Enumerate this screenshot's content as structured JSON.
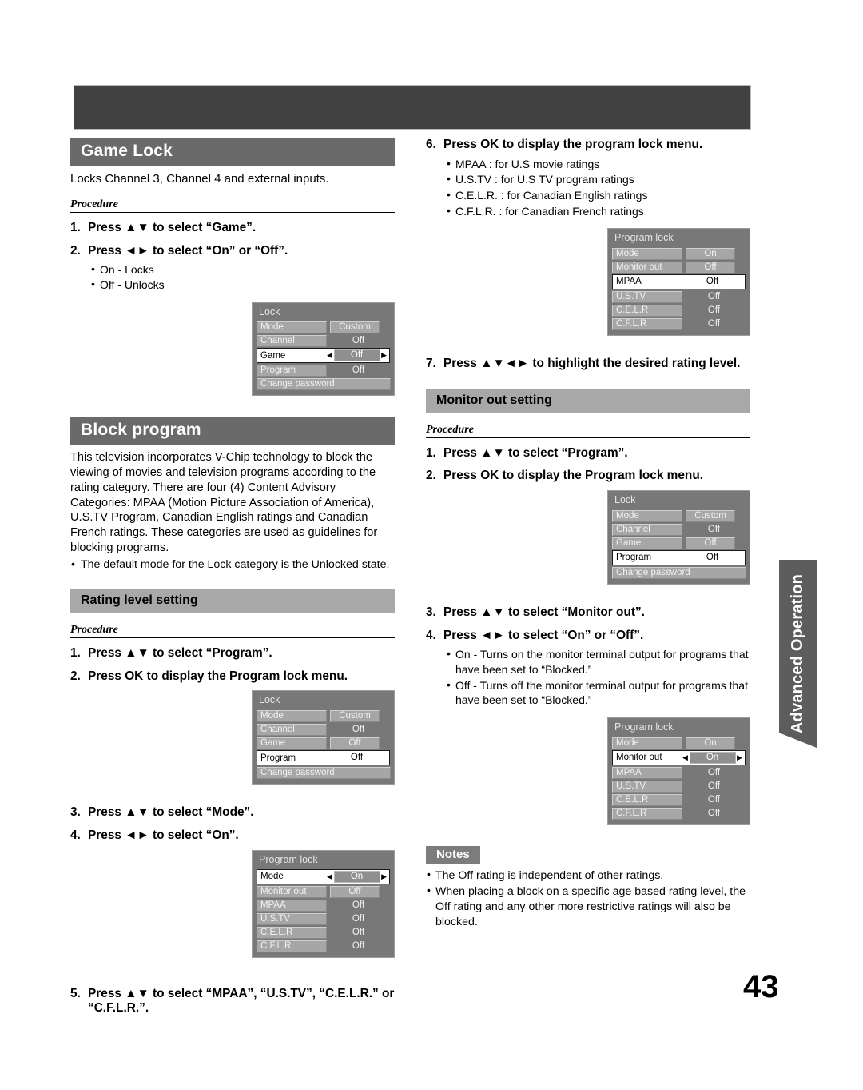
{
  "page": {
    "number": "43",
    "side_tab": "Advanced Operation"
  },
  "game_lock": {
    "heading": "Game Lock",
    "intro": "Locks Channel 3, Channel 4 and external inputs.",
    "procedure_label": "Procedure",
    "steps": [
      {
        "num": "1.",
        "text": "Press ▲▼ to select “Game”."
      },
      {
        "num": "2.",
        "text": "Press ◄► to select “On” or “Off”."
      }
    ],
    "bullets": [
      "On - Locks",
      "Off - Unlocks"
    ],
    "osd": {
      "title": "Lock",
      "rows": [
        {
          "label": "Mode",
          "value": "Custom",
          "style": "boxed",
          "selected": false
        },
        {
          "label": "Channel",
          "value": "Off",
          "style": "plain",
          "selected": false
        },
        {
          "label": "Game",
          "value": "Off",
          "style": "boxed",
          "selected": true
        },
        {
          "label": "Program",
          "value": "Off",
          "style": "plain",
          "selected": false
        },
        {
          "label": "Change password",
          "value": "",
          "style": "none",
          "selected": false
        }
      ]
    }
  },
  "block_program": {
    "heading": "Block program",
    "paragraph": "This television incorporates V-Chip technology to block the viewing of movies and television programs according to the rating category. There are four (4) Content Advisory Categories: MPAA (Motion Picture Association of America), U.S.TV Program, Canadian English ratings and Canadian French ratings. These categories are used as guidelines for blocking programs.",
    "note": "The default mode for the Lock category is the Unlocked state."
  },
  "rating_level": {
    "heading": "Rating level setting",
    "procedure_label": "Procedure",
    "steps_a": [
      {
        "num": "1.",
        "text": "Press ▲▼ to select “Program”."
      },
      {
        "num": "2.",
        "text": "Press OK to display the Program lock menu."
      }
    ],
    "osd_a": {
      "title": "Lock",
      "rows": [
        {
          "label": "Mode",
          "value": "Custom",
          "style": "boxed",
          "selected": false
        },
        {
          "label": "Channel",
          "value": "Off",
          "style": "plain",
          "selected": false
        },
        {
          "label": "Game",
          "value": "Off",
          "style": "boxed",
          "selected": false
        },
        {
          "label": "Program",
          "value": "Off",
          "style": "plain",
          "selected": true
        },
        {
          "label": "Change password",
          "value": "",
          "style": "none",
          "selected": false
        }
      ]
    },
    "steps_b": [
      {
        "num": "3.",
        "text": "Press ▲▼ to select “Mode”."
      },
      {
        "num": "4.",
        "text": "Press ◄► to select “On”."
      }
    ],
    "osd_b": {
      "title": "Program lock",
      "rows": [
        {
          "label": "Mode",
          "value": "On",
          "style": "boxed",
          "selected": true
        },
        {
          "label": "Monitor out",
          "value": "Off",
          "style": "boxed",
          "selected": false
        },
        {
          "label": "MPAA",
          "value": "Off",
          "style": "plain",
          "selected": false
        },
        {
          "label": "U.S.TV",
          "value": "Off",
          "style": "plain",
          "selected": false
        },
        {
          "label": "C.E.L.R",
          "value": "Off",
          "style": "plain",
          "selected": false
        },
        {
          "label": "C.F.L.R",
          "value": "Off",
          "style": "plain",
          "selected": false
        }
      ]
    },
    "step5": {
      "num": "5.",
      "text": "Press ▲▼ to select “MPAA”, “U.S.TV”, “C.E.L.R.” or “C.F.L.R.”."
    },
    "step6": {
      "num": "6.",
      "text": "Press OK to display the program lock menu."
    },
    "step6_bullets": [
      "MPAA : for U.S movie ratings",
      "U.S.TV : for U.S TV program ratings",
      "C.E.L.R. : for Canadian English ratings",
      "C.F.L.R. : for Canadian French ratings"
    ],
    "osd_c": {
      "title": "Program lock",
      "rows": [
        {
          "label": "Mode",
          "value": "On",
          "style": "boxed",
          "selected": false
        },
        {
          "label": "Monitor out",
          "value": "Off",
          "style": "boxed",
          "selected": false
        },
        {
          "label": "MPAA",
          "value": "Off",
          "style": "plain",
          "selected": true
        },
        {
          "label": "U.S.TV",
          "value": "Off",
          "style": "plain",
          "selected": false
        },
        {
          "label": "C.E.L.R",
          "value": "Off",
          "style": "plain",
          "selected": false
        },
        {
          "label": "C.F.L.R",
          "value": "Off",
          "style": "plain",
          "selected": false
        }
      ]
    },
    "step7": {
      "num": "7.",
      "text": "Press ▲▼◄► to highlight the desired rating level."
    }
  },
  "monitor_out": {
    "heading": "Monitor out setting",
    "procedure_label": "Procedure",
    "steps_a": [
      {
        "num": "1.",
        "text": "Press ▲▼ to select “Program”."
      },
      {
        "num": "2.",
        "text": "Press OK to display the Program lock menu."
      }
    ],
    "osd_a": {
      "title": "Lock",
      "rows": [
        {
          "label": "Mode",
          "value": "Custom",
          "style": "boxed",
          "selected": false
        },
        {
          "label": "Channel",
          "value": "Off",
          "style": "plain",
          "selected": false
        },
        {
          "label": "Game",
          "value": "Off",
          "style": "boxed",
          "selected": false
        },
        {
          "label": "Program",
          "value": "Off",
          "style": "plain",
          "selected": true
        },
        {
          "label": "Change password",
          "value": "",
          "style": "none",
          "selected": false
        }
      ]
    },
    "steps_b": [
      {
        "num": "3.",
        "text": "Press ▲▼ to select “Monitor out”."
      },
      {
        "num": "4.",
        "text": "Press ◄► to select “On” or “Off”."
      }
    ],
    "bullets": [
      "On - Turns on the monitor terminal output for programs that have been set to “Blocked.”",
      "Off - Turns off the monitor terminal output for programs that have been set to “Blocked.”"
    ],
    "osd_b": {
      "title": "Program lock",
      "rows": [
        {
          "label": "Mode",
          "value": "On",
          "style": "boxed",
          "selected": false
        },
        {
          "label": "Monitor out",
          "value": "On",
          "style": "boxed",
          "selected": true
        },
        {
          "label": "MPAA",
          "value": "Off",
          "style": "plain",
          "selected": false
        },
        {
          "label": "U.S.TV",
          "value": "Off",
          "style": "plain",
          "selected": false
        },
        {
          "label": "C.E.L.R",
          "value": "Off",
          "style": "plain",
          "selected": false
        },
        {
          "label": "C.F.L.R",
          "value": "Off",
          "style": "plain",
          "selected": false
        }
      ]
    }
  },
  "notes": {
    "label": "Notes",
    "items": [
      "The Off rating is independent of other ratings.",
      "When placing a block on a specific age based rating level, the Off rating and any other more restrictive ratings will also be blocked."
    ]
  }
}
